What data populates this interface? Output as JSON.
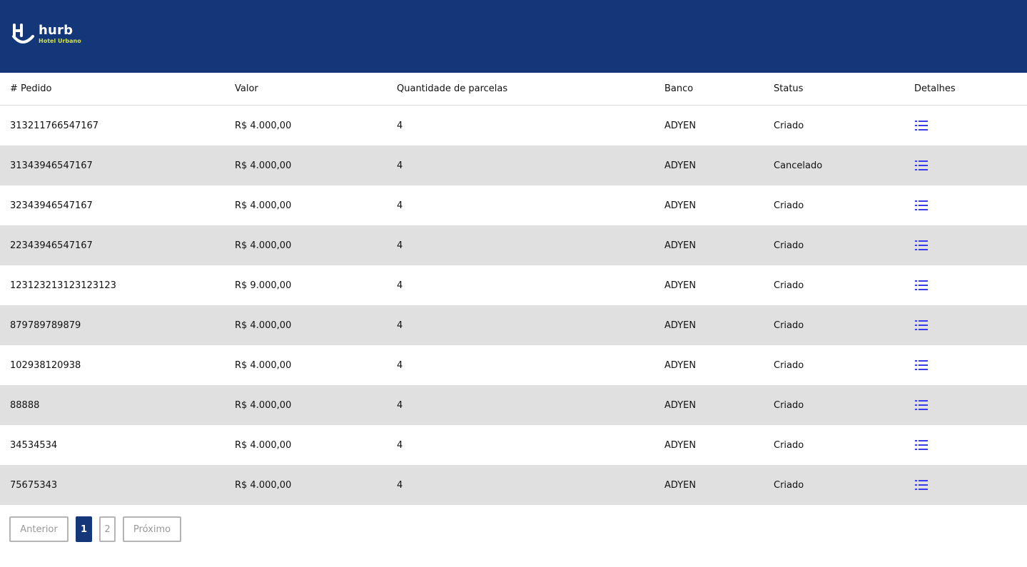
{
  "header": {
    "brand_name": "hurb",
    "brand_sub": "Hotel Urbano",
    "bg_color": "#14377a",
    "accent_color": "#cfe04a"
  },
  "table": {
    "columns": [
      "# Pedido",
      "Valor",
      "Quantidade de parcelas",
      "Banco",
      "Status",
      "Detalhes"
    ],
    "rows": [
      {
        "pedido": "313211766547167",
        "valor": "R$ 4.000,00",
        "parcelas": "4",
        "banco": "ADYEN",
        "status": "Criado"
      },
      {
        "pedido": "31343946547167",
        "valor": "R$ 4.000,00",
        "parcelas": "4",
        "banco": "ADYEN",
        "status": "Cancelado"
      },
      {
        "pedido": "32343946547167",
        "valor": "R$ 4.000,00",
        "parcelas": "4",
        "banco": "ADYEN",
        "status": "Criado"
      },
      {
        "pedido": "22343946547167",
        "valor": "R$ 4.000,00",
        "parcelas": "4",
        "banco": "ADYEN",
        "status": "Criado"
      },
      {
        "pedido": "123123213123123123",
        "valor": "R$ 9.000,00",
        "parcelas": "4",
        "banco": "ADYEN",
        "status": "Criado"
      },
      {
        "pedido": "879789789879",
        "valor": "R$ 4.000,00",
        "parcelas": "4",
        "banco": "ADYEN",
        "status": "Criado"
      },
      {
        "pedido": "102938120938",
        "valor": "R$ 4.000,00",
        "parcelas": "4",
        "banco": "ADYEN",
        "status": "Criado"
      },
      {
        "pedido": "88888",
        "valor": "R$ 4.000,00",
        "parcelas": "4",
        "banco": "ADYEN",
        "status": "Criado"
      },
      {
        "pedido": "34534534",
        "valor": "R$ 4.000,00",
        "parcelas": "4",
        "banco": "ADYEN",
        "status": "Criado"
      },
      {
        "pedido": "75675343",
        "valor": "R$ 4.000,00",
        "parcelas": "4",
        "banco": "ADYEN",
        "status": "Criado"
      }
    ],
    "details_icon": "list-icon",
    "icon_color": "#3a3af0",
    "stripe_color": "#e0e0e0"
  },
  "pagination": {
    "prev_label": "Anterior",
    "pages": [
      "1",
      "2"
    ],
    "current_page": "1",
    "next_label": "Próximo"
  }
}
